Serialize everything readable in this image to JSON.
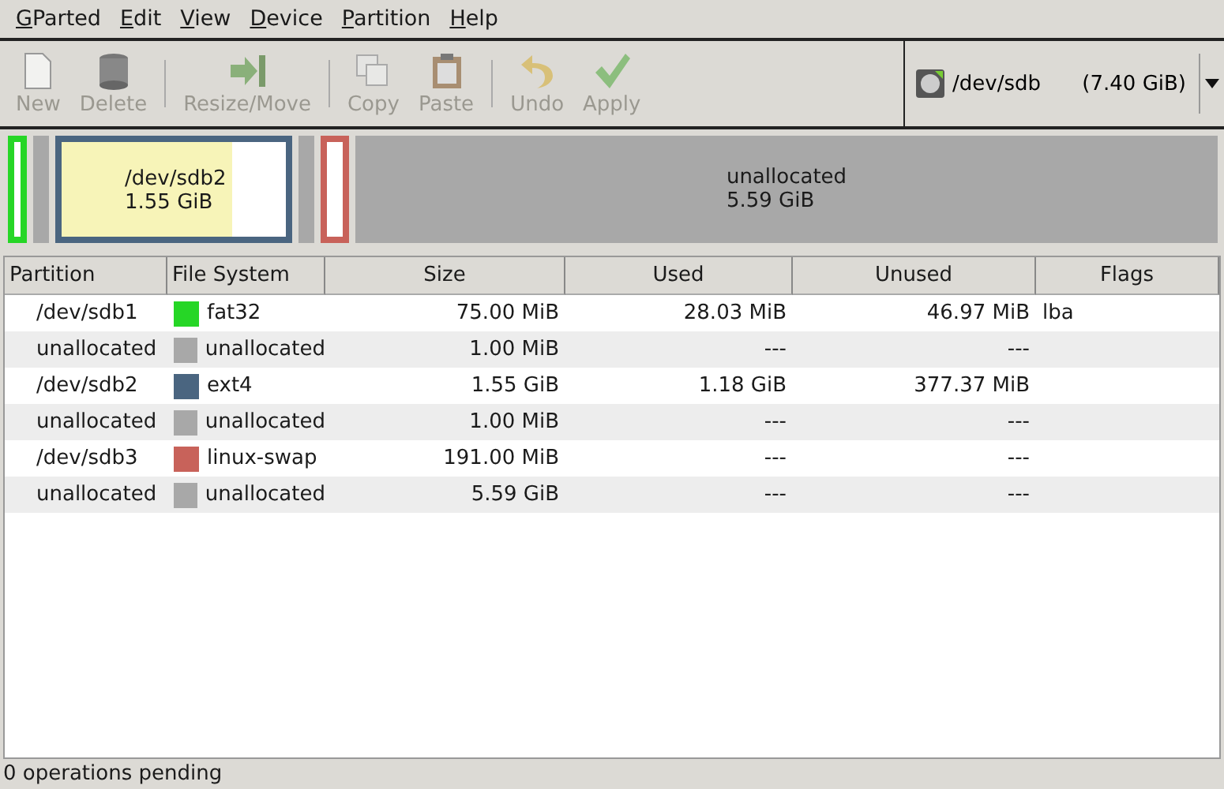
{
  "menu": [
    "GParted",
    "Edit",
    "View",
    "Device",
    "Partition",
    "Help"
  ],
  "toolbar": [
    {
      "label": "New",
      "kind": "new",
      "disabled": true
    },
    {
      "label": "Delete",
      "kind": "delete",
      "disabled": true
    },
    {
      "label": "Resize/Move",
      "kind": "resize",
      "disabled": true
    },
    {
      "label": "Copy",
      "kind": "copy",
      "disabled": true
    },
    {
      "label": "Paste",
      "kind": "paste",
      "disabled": true
    },
    {
      "label": "Undo",
      "kind": "undo",
      "disabled": true
    },
    {
      "label": "Apply",
      "kind": "apply",
      "disabled": true
    }
  ],
  "device": {
    "name": "/dev/sdb",
    "size": "(7.40 GiB)"
  },
  "disk_map": [
    {
      "kind": "partition",
      "color": "#26d626"
    },
    {
      "kind": "unallocated"
    },
    {
      "kind": "partition",
      "color": "#4a6580",
      "name": "/dev/sdb2",
      "size": "1.55 GiB",
      "level": 0.76
    },
    {
      "kind": "unallocated"
    },
    {
      "kind": "partition",
      "color": "#c8625a"
    },
    {
      "kind": "unallocated",
      "name": "unallocated",
      "size": "5.59 GiB"
    }
  ],
  "table": {
    "columns": [
      "Partition",
      "File System",
      "Size",
      "Used",
      "Unused",
      "Flags"
    ],
    "rows": [
      {
        "partition": "/dev/sdb1",
        "fs": "fat32",
        "color": "#26d626",
        "size": "75.00 MiB",
        "used": "28.03 MiB",
        "unused": "46.97 MiB",
        "flags": "lba"
      },
      {
        "partition": "unallocated",
        "fs": "unallocated",
        "color": "#a8a8a8",
        "size": "1.00 MiB",
        "used": "---",
        "unused": "---"
      },
      {
        "partition": "/dev/sdb2",
        "fs": "ext4",
        "color": "#4a6580",
        "size": "1.55 GiB",
        "used": "1.18 GiB",
        "unused": "377.37 MiB"
      },
      {
        "partition": "unallocated",
        "fs": "unallocated",
        "color": "#a8a8a8",
        "size": "1.00 MiB",
        "used": "---",
        "unused": "---"
      },
      {
        "partition": "/dev/sdb3",
        "fs": "linux-swap",
        "color": "#c8625a",
        "size": "191.00 MiB",
        "used": "---",
        "unused": "---"
      },
      {
        "partition": "unallocated",
        "fs": "unallocated",
        "color": "#a8a8a8",
        "size": "5.59 GiB",
        "used": "---",
        "unused": "---"
      }
    ]
  },
  "status_bar": "0 operations pending"
}
